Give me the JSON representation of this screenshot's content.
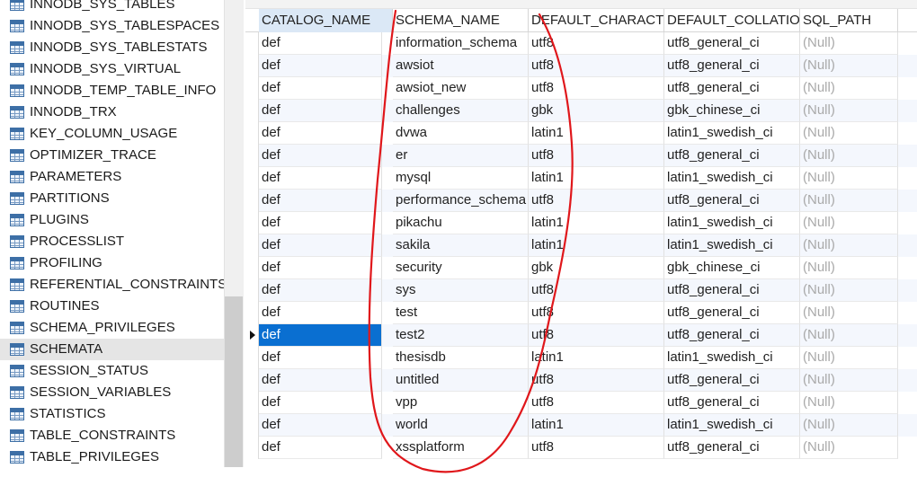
{
  "tree": {
    "items": [
      {
        "label": "INNODB_SYS_TABLES",
        "selected": false
      },
      {
        "label": "INNODB_SYS_TABLESPACES",
        "selected": false
      },
      {
        "label": "INNODB_SYS_TABLESTATS",
        "selected": false
      },
      {
        "label": "INNODB_SYS_VIRTUAL",
        "selected": false
      },
      {
        "label": "INNODB_TEMP_TABLE_INFO",
        "selected": false
      },
      {
        "label": "INNODB_TRX",
        "selected": false
      },
      {
        "label": "KEY_COLUMN_USAGE",
        "selected": false
      },
      {
        "label": "OPTIMIZER_TRACE",
        "selected": false
      },
      {
        "label": "PARAMETERS",
        "selected": false
      },
      {
        "label": "PARTITIONS",
        "selected": false
      },
      {
        "label": "PLUGINS",
        "selected": false
      },
      {
        "label": "PROCESSLIST",
        "selected": false
      },
      {
        "label": "PROFILING",
        "selected": false
      },
      {
        "label": "REFERENTIAL_CONSTRAINTS",
        "selected": false
      },
      {
        "label": "ROUTINES",
        "selected": false
      },
      {
        "label": "SCHEMA_PRIVILEGES",
        "selected": false
      },
      {
        "label": "SCHEMATA",
        "selected": true
      },
      {
        "label": "SESSION_STATUS",
        "selected": false
      },
      {
        "label": "SESSION_VARIABLES",
        "selected": false
      },
      {
        "label": "STATISTICS",
        "selected": false
      },
      {
        "label": "TABLE_CONSTRAINTS",
        "selected": false
      },
      {
        "label": "TABLE_PRIVILEGES",
        "selected": false
      }
    ]
  },
  "grid": {
    "columns": [
      "CATALOG_NAME",
      "SCHEMA_NAME",
      "DEFAULT_CHARACT",
      "DEFAULT_COLLATIO",
      "SQL_PATH"
    ],
    "rows": [
      [
        "def",
        "information_schema",
        "utf8",
        "utf8_general_ci",
        "(Null)"
      ],
      [
        "def",
        "awsiot",
        "utf8",
        "utf8_general_ci",
        "(Null)"
      ],
      [
        "def",
        "awsiot_new",
        "utf8",
        "utf8_general_ci",
        "(Null)"
      ],
      [
        "def",
        "challenges",
        "gbk",
        "gbk_chinese_ci",
        "(Null)"
      ],
      [
        "def",
        "dvwa",
        "latin1",
        "latin1_swedish_ci",
        "(Null)"
      ],
      [
        "def",
        "er",
        "utf8",
        "utf8_general_ci",
        "(Null)"
      ],
      [
        "def",
        "mysql",
        "latin1",
        "latin1_swedish_ci",
        "(Null)"
      ],
      [
        "def",
        "performance_schema",
        "utf8",
        "utf8_general_ci",
        "(Null)"
      ],
      [
        "def",
        "pikachu",
        "latin1",
        "latin1_swedish_ci",
        "(Null)"
      ],
      [
        "def",
        "sakila",
        "latin1",
        "latin1_swedish_ci",
        "(Null)"
      ],
      [
        "def",
        "security",
        "gbk",
        "gbk_chinese_ci",
        "(Null)"
      ],
      [
        "def",
        "sys",
        "utf8",
        "utf8_general_ci",
        "(Null)"
      ],
      [
        "def",
        "test",
        "utf8",
        "utf8_general_ci",
        "(Null)"
      ],
      [
        "def",
        "test2",
        "utf8",
        "utf8_general_ci",
        "(Null)"
      ],
      [
        "def",
        "thesisdb",
        "latin1",
        "latin1_swedish_ci",
        "(Null)"
      ],
      [
        "def",
        "untitled",
        "utf8",
        "utf8_general_ci",
        "(Null)"
      ],
      [
        "def",
        "vpp",
        "utf8",
        "utf8_general_ci",
        "(Null)"
      ],
      [
        "def",
        "world",
        "latin1",
        "latin1_swedish_ci",
        "(Null)"
      ],
      [
        "def",
        "xssplatform",
        "utf8",
        "utf8_general_ci",
        "(Null)"
      ]
    ],
    "current_row": 13,
    "null_color": "#a9a9a9",
    "selection_color": "#0a6fd1",
    "annotation_color": "#e0171b"
  }
}
